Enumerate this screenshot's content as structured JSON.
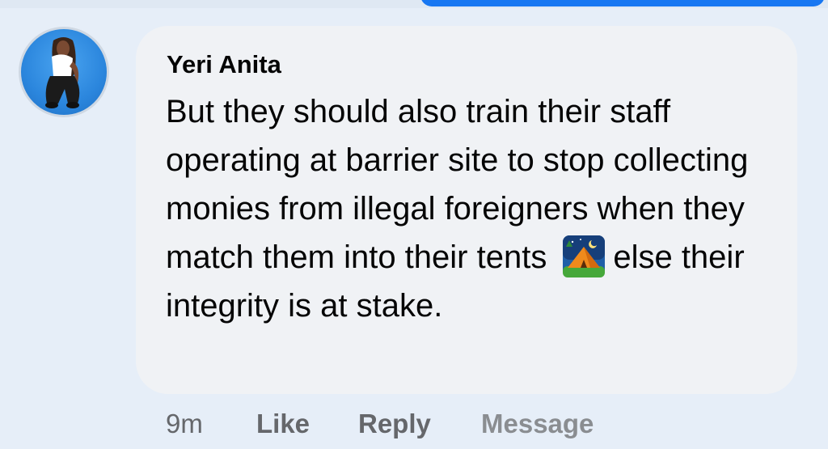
{
  "comment": {
    "author": "Yeri Anita",
    "text_before_emoji": "But they should also train their staff operating at barrier site to stop collecting monies from illegal foreigners when they match them into their tents",
    "emoji": "tent-at-night-emoji",
    "text_after_emoji": "else their integrity is at stake."
  },
  "actions": {
    "time": "9m",
    "like": "Like",
    "reply": "Reply",
    "message": "Message"
  },
  "colors": {
    "background": "#e6eef8",
    "bubble": "#f0f2f5",
    "accent": "#1877f2",
    "secondary_text": "#65676b"
  },
  "icons": {
    "avatar": "profile-photo",
    "emoji": "tent-icon"
  }
}
